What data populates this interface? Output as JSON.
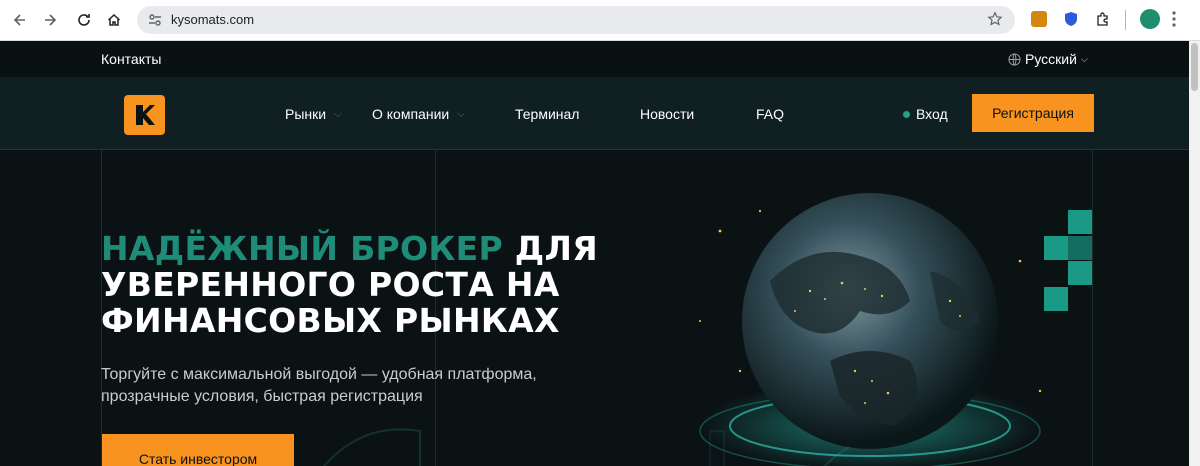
{
  "browser": {
    "url": "kysomats.com"
  },
  "topbar": {
    "contacts": "Контакты",
    "language": "Русский"
  },
  "header": {
    "menu": [
      {
        "label": "Рынки",
        "has_dropdown": true
      },
      {
        "label": "О компании",
        "has_dropdown": true
      },
      {
        "label": "Терминал",
        "has_dropdown": false
      },
      {
        "label": "Новости",
        "has_dropdown": false
      },
      {
        "label": "FAQ",
        "has_dropdown": false
      }
    ],
    "login": "Вход",
    "register": "Регистрация"
  },
  "hero": {
    "title_accent": "НАДЁЖНЫЙ БРОКЕР",
    "title_rest": " ДЛЯ УВЕРЕННОГО РОСТА НА ФИНАНСОВЫХ РЫНКАХ",
    "subtitle": "Торгуйте с максимальной выгодой — удобная платформа, прозрачные условия, быстрая регистрация",
    "cta": "Стать инвестором"
  },
  "colors": {
    "accent": "#f7931e",
    "teal": "#1f8c7a",
    "background": "#0b1214"
  },
  "icons": [
    "back-icon",
    "forward-icon",
    "reload-icon",
    "home-icon",
    "site-info-icon",
    "star-icon",
    "extension-icon",
    "profile-icon",
    "globe-icon",
    "chevron-down-icon",
    "logo-icon"
  ]
}
